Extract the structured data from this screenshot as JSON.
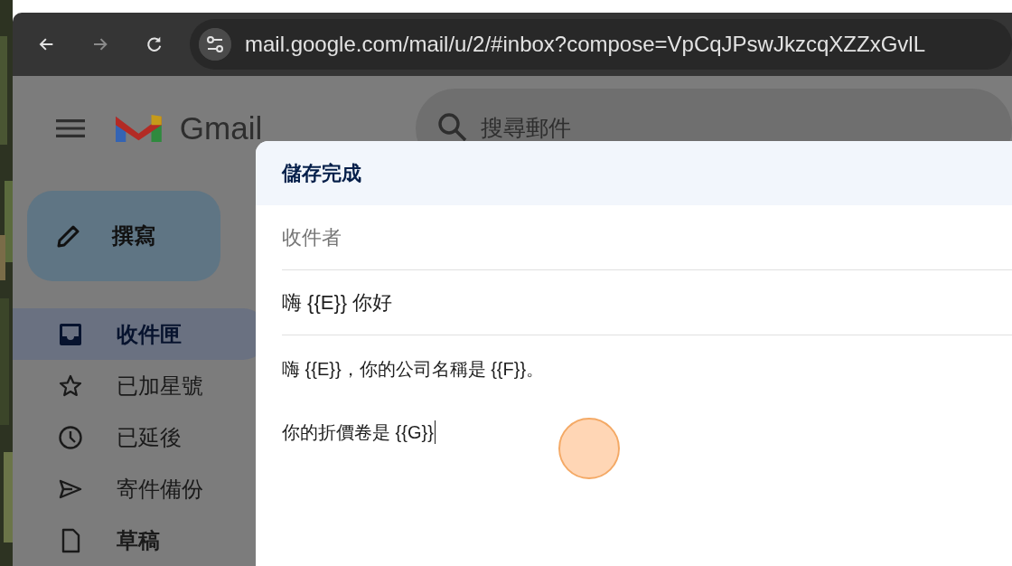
{
  "browser": {
    "url": "mail.google.com/mail/u/2/#inbox?compose=VpCqJPswJkzcqXZZxGvlL"
  },
  "gmail": {
    "product_name": "Gmail",
    "search": {
      "placeholder": "搜尋郵件"
    },
    "compose_button": "撰寫",
    "sidebar": {
      "items": [
        {
          "kind": "inbox",
          "label": "收件匣",
          "selected": true,
          "unread": true
        },
        {
          "kind": "starred",
          "label": "已加星號",
          "selected": false,
          "unread": false
        },
        {
          "kind": "snoozed",
          "label": "已延後",
          "selected": false,
          "unread": false
        },
        {
          "kind": "sent",
          "label": "寄件備份",
          "selected": false,
          "unread": false
        },
        {
          "kind": "drafts",
          "label": "草稿",
          "selected": false,
          "unread": true
        }
      ]
    }
  },
  "compose": {
    "title": "儲存完成",
    "to": {
      "placeholder": "收件者"
    },
    "subject": "嗨 {{E}} 你好",
    "body": [
      "嗨 {{E}}，你的公司名稱是 {{F}}。",
      "你的折價卷是 {{G}}"
    ]
  }
}
